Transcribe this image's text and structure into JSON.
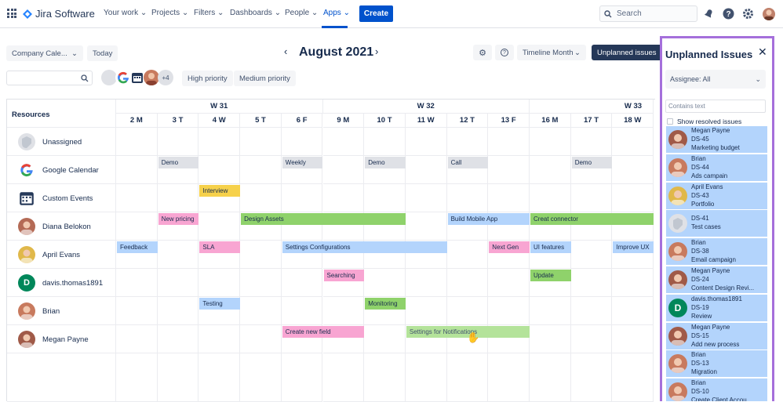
{
  "nav": {
    "brand": "Jira Software",
    "items": [
      "Your work",
      "Projects",
      "Filters",
      "Dashboards",
      "People",
      "Apps"
    ],
    "create": "Create",
    "search_placeholder": "Search"
  },
  "toolbar": {
    "calendar_select": "Company Cale...",
    "today": "Today",
    "month_title": "August 2021",
    "timeline_select": "Timeline Month",
    "unplanned_button": "Unplanned issues",
    "more_count": "+4",
    "filter_high": "High priority",
    "filter_medium": "Medium priority"
  },
  "calendar": {
    "resources_label": "Resources",
    "weeks": [
      "W 31",
      "W 32",
      "W 33"
    ],
    "days": [
      "2 M",
      "3 T",
      "4 W",
      "5 T",
      "6 F",
      "9 M",
      "10 T",
      "11 W",
      "12 T",
      "13 F",
      "16 M",
      "17 T",
      "18 W"
    ],
    "resources": [
      "Unassigned",
      "Google Calendar",
      "Custom Events",
      "Diana Belokon",
      "April Evans",
      "davis.thomas1891",
      "Brian",
      "Megan Payne"
    ],
    "events": [
      {
        "label": "Demo",
        "row": 1,
        "start": 1,
        "span": 1,
        "color": "#dfe1e6"
      },
      {
        "label": "Weekly",
        "row": 1,
        "start": 4,
        "span": 1,
        "color": "#dfe1e6"
      },
      {
        "label": "Demo",
        "row": 1,
        "start": 6,
        "span": 1,
        "color": "#dfe1e6"
      },
      {
        "label": "Call",
        "row": 1,
        "start": 8,
        "span": 1,
        "color": "#dfe1e6"
      },
      {
        "label": "Demo",
        "row": 1,
        "start": 11,
        "span": 1,
        "color": "#dfe1e6"
      },
      {
        "label": "Interview",
        "row": 2,
        "start": 2,
        "span": 1,
        "color": "#f6d14b"
      },
      {
        "label": "New pricing",
        "row": 3,
        "start": 1,
        "span": 1,
        "color": "#f8a5d2"
      },
      {
        "label": "Design Assets",
        "row": 3,
        "start": 3,
        "span": 4,
        "color": "#8fd26b"
      },
      {
        "label": "Build Mobile App",
        "row": 3,
        "start": 8,
        "span": 2,
        "color": "#b3d4fc"
      },
      {
        "label": "Creat connector",
        "row": 3,
        "start": 10,
        "span": 3,
        "color": "#8fd26b"
      },
      {
        "label": "Feedback",
        "row": 4,
        "start": 0,
        "span": 1,
        "color": "#b3d4fc"
      },
      {
        "label": "SLA",
        "row": 4,
        "start": 2,
        "span": 1,
        "color": "#f8a5d2"
      },
      {
        "label": "Settings Configurations",
        "row": 4,
        "start": 4,
        "span": 4,
        "color": "#b3d4fc"
      },
      {
        "label": "Next Gen",
        "row": 4,
        "start": 9,
        "span": 1,
        "color": "#f8a5d2"
      },
      {
        "label": "UI features",
        "row": 4,
        "start": 10,
        "span": 1,
        "color": "#b3d4fc"
      },
      {
        "label": "Improve UX",
        "row": 4,
        "start": 12,
        "span": 1,
        "color": "#b3d4fc"
      },
      {
        "label": "Searching",
        "row": 5,
        "start": 5,
        "span": 1,
        "color": "#f8a5d2"
      },
      {
        "label": "Update",
        "row": 5,
        "start": 10,
        "span": 1,
        "color": "#8fd26b"
      },
      {
        "label": "Testing",
        "row": 6,
        "start": 2,
        "span": 1,
        "color": "#b3d4fc"
      },
      {
        "label": "Monitoring",
        "row": 6,
        "start": 6,
        "span": 1,
        "color": "#8fd26b"
      },
      {
        "label": "Create new field",
        "row": 7,
        "start": 4,
        "span": 2,
        "color": "#f8a5d2"
      },
      {
        "label": "Settings for Notifications",
        "row": 7,
        "start": 7,
        "span": 3,
        "color": "#b4e39a"
      }
    ]
  },
  "panel": {
    "title": "Unplanned Issues",
    "assignee": "Assignee: All",
    "contains_placeholder": "Contains text",
    "show_resolved": "Show resolved issues",
    "cards": [
      {
        "name": "Megan Payne",
        "key": "DS-45",
        "summary": "Marketing budget",
        "avatar": "megan"
      },
      {
        "name": "Brian",
        "key": "DS-44",
        "summary": "Ads campain",
        "avatar": "brian"
      },
      {
        "name": "April Evans",
        "key": "DS-43",
        "summary": "Portfolio",
        "avatar": "april"
      },
      {
        "name": "",
        "key": "DS-41",
        "summary": "Test cases",
        "avatar": "unassigned"
      },
      {
        "name": "Brian",
        "key": "DS-38",
        "summary": "Email campaign",
        "avatar": "brian"
      },
      {
        "name": "Megan Payne",
        "key": "DS-24",
        "summary": "Content Design Revi...",
        "avatar": "megan"
      },
      {
        "name": "davis.thomas1891",
        "key": "DS-19",
        "summary": "Review",
        "avatar": "davis"
      },
      {
        "name": "Megan Payne",
        "key": "DS-15",
        "summary": "Add new process",
        "avatar": "megan"
      },
      {
        "name": "Brian",
        "key": "DS-13",
        "summary": "Migration",
        "avatar": "brian"
      },
      {
        "name": "Brian",
        "key": "DS-10",
        "summary": "Create Client Accou...",
        "avatar": "brian"
      }
    ]
  }
}
